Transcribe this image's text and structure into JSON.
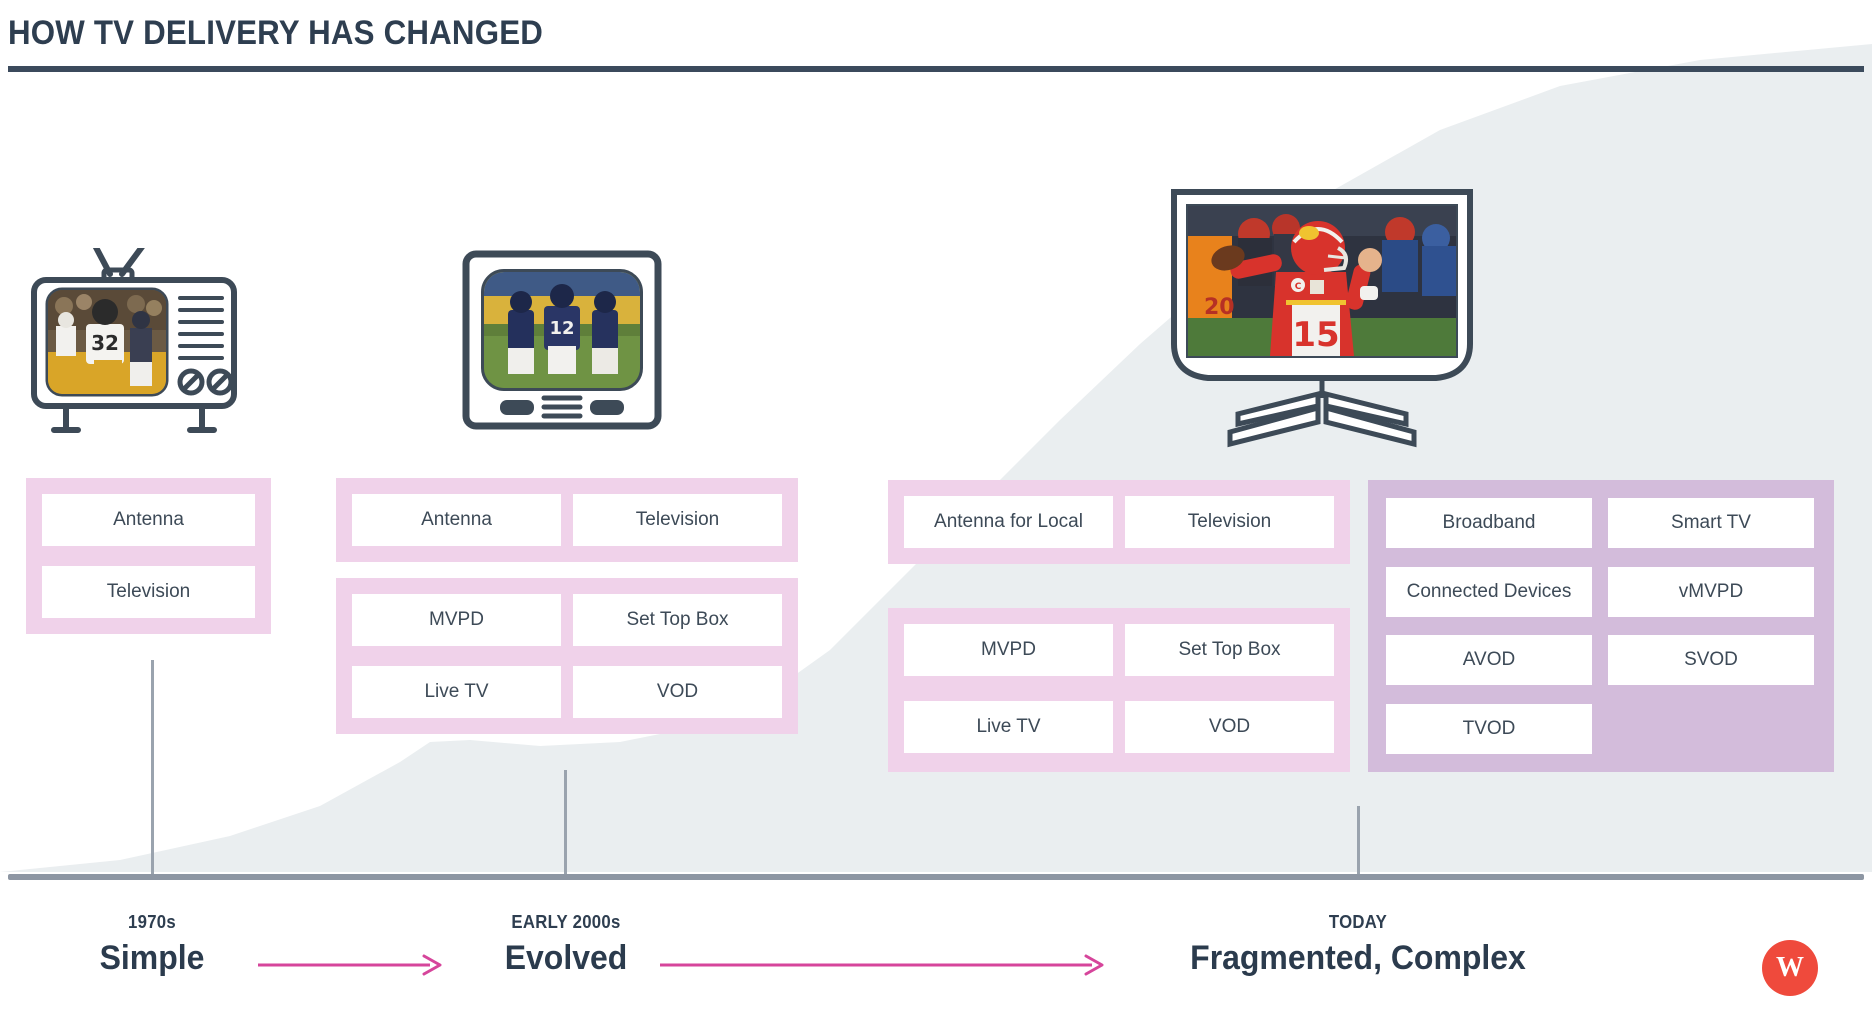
{
  "header": {
    "title": "HOW TV DELIVERY HAS CHANGED"
  },
  "colors": {
    "title_navy": "#2e3e50",
    "rule_navy": "#3b4a5c",
    "panel_light_pink": "#f0d2ea",
    "panel_dark_mauve": "#d3bcdb",
    "cell_white": "#ffffff",
    "label_slate": "#3d4a57",
    "arrow_pink": "#d6459b",
    "timeline_gray": "#8d96a3",
    "background_mountain": "#eaeef0",
    "logo_red": "#ef4a3c"
  },
  "columns": [
    {
      "id": "simple",
      "era_year": "1970s",
      "era_name": "Simple",
      "tv_icon": "crt-tv-with-antenna-icon",
      "tv_caption": "vintage football broadcast",
      "groups": [
        {
          "tone": "light",
          "rows": [
            [
              "Antenna"
            ],
            [
              "Television"
            ]
          ]
        }
      ]
    },
    {
      "id": "evolved",
      "era_year": "EARLY 2000s",
      "era_name": "Evolved",
      "tv_icon": "boxy-crt-tv-icon",
      "tv_caption": "early 2000s football broadcast",
      "groups": [
        {
          "tone": "light",
          "rows": [
            [
              "Antenna",
              "Television"
            ]
          ]
        },
        {
          "tone": "light",
          "rows": [
            [
              "MVPD",
              "Set Top Box"
            ],
            [
              "Live TV",
              "VOD"
            ]
          ]
        }
      ]
    },
    {
      "id": "today",
      "era_year": "TODAY",
      "era_name": "Fragmented, Complex",
      "tv_icon": "flat-screen-tv-icon",
      "tv_caption": "modern football broadcast",
      "groups": [
        {
          "tone": "light",
          "rows": [
            [
              "Antenna for Local",
              "Television"
            ]
          ]
        },
        {
          "tone": "light",
          "rows": [
            [
              "MVPD",
              "Set Top Box"
            ],
            [
              "Live TV",
              "VOD"
            ]
          ]
        },
        {
          "tone": "dark",
          "rows": [
            [
              "Broadband",
              "Smart TV"
            ],
            [
              "Connected Devices",
              "vMVPD"
            ],
            [
              "AVOD",
              "SVOD"
            ],
            [
              "TVOD",
              ""
            ]
          ]
        }
      ]
    }
  ],
  "arrows": [
    {
      "from": "Simple",
      "to": "Evolved"
    },
    {
      "from": "Evolved",
      "to": "Fragmented, Complex"
    }
  ],
  "logo": {
    "letter": "W",
    "name": "w-logo-badge"
  },
  "cells": {
    "c1_antenna": "Antenna",
    "c1_television": "Television",
    "c2_antenna": "Antenna",
    "c2_television": "Television",
    "c2_mvpd": "MVPD",
    "c2_stb": "Set Top Box",
    "c2_livetv": "Live TV",
    "c2_vod": "VOD",
    "c3_antenna_local": "Antenna for Local",
    "c3_television": "Television",
    "c3_mvpd": "MVPD",
    "c3_stb": "Set Top Box",
    "c3_livetv": "Live TV",
    "c3_vod": "VOD",
    "c3_broadband": "Broadband",
    "c3_smarttv": "Smart TV",
    "c3_connected": "Connected Devices",
    "c3_vmvpd": "vMVPD",
    "c3_avod": "AVOD",
    "c3_svod": "SVOD",
    "c3_tvod": "TVOD"
  },
  "eras": {
    "e1_year": "1970s",
    "e1_name": "Simple",
    "e2_year": "EARLY 2000s",
    "e2_name": "Evolved",
    "e3_year": "TODAY",
    "e3_name": "Fragmented, Complex"
  }
}
